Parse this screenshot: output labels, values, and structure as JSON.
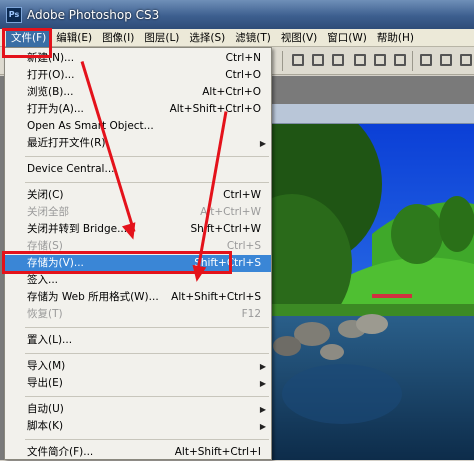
{
  "window": {
    "title": "Adobe Photoshop CS3",
    "logo": "Ps"
  },
  "menubar": [
    "文件(F)",
    "编辑(E)",
    "图像(I)",
    "图层(L)",
    "选择(S)",
    "滤镜(T)",
    "视图(V)",
    "窗口(W)",
    "帮助(H)"
  ],
  "file_menu": {
    "items": [
      {
        "label": "新建(N)...",
        "shortcut": "Ctrl+N"
      },
      {
        "label": "打开(O)...",
        "shortcut": "Ctrl+O"
      },
      {
        "label": "浏览(B)...",
        "shortcut": "Alt+Ctrl+O"
      },
      {
        "label": "打开为(A)...",
        "shortcut": "Alt+Shift+Ctrl+O"
      },
      {
        "label": "Open As Smart Object...",
        "shortcut": ""
      },
      {
        "label": "最近打开文件(R)",
        "shortcut": ""
      },
      {
        "label": "Device Central...",
        "shortcut": ""
      },
      {
        "label": "关闭(C)",
        "shortcut": "Ctrl+W"
      },
      {
        "label": "关闭全部",
        "shortcut": "Alt+Ctrl+W"
      },
      {
        "label": "关闭并转到 Bridge...",
        "shortcut": "Shift+Ctrl+W"
      },
      {
        "label": "存储(S)",
        "shortcut": "Ctrl+S"
      },
      {
        "label": "存储为(V)...",
        "shortcut": "Shift+Ctrl+S"
      },
      {
        "label": "签入...",
        "shortcut": ""
      },
      {
        "label": "存储为 Web 所用格式(W)...",
        "shortcut": "Alt+Shift+Ctrl+S"
      },
      {
        "label": "恢复(T)",
        "shortcut": "F12"
      },
      {
        "label": "置入(L)...",
        "shortcut": ""
      },
      {
        "label": "导入(M)",
        "shortcut": ""
      },
      {
        "label": "导出(E)",
        "shortcut": ""
      },
      {
        "label": "自动(U)",
        "shortcut": ""
      },
      {
        "label": "脚本(K)",
        "shortcut": ""
      },
      {
        "label": "文件简介(F)...",
        "shortcut": "Alt+Shift+Ctrl+I"
      }
    ]
  },
  "colors": {
    "highlight": "#3a86d6",
    "annotation": "#e4121b"
  }
}
